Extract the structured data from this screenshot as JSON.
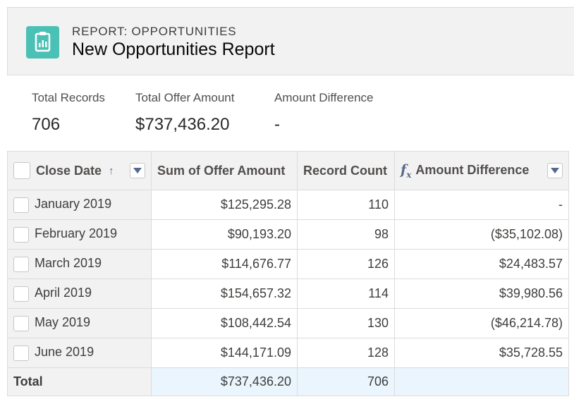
{
  "header": {
    "eyebrow": "REPORT: OPPORTUNITIES",
    "title": "New Opportunities Report",
    "icon": "report-icon",
    "icon_color": "#4bc1b6"
  },
  "summary": [
    {
      "label": "Total Records",
      "value": "706"
    },
    {
      "label": "Total Offer Amount",
      "value": "$737,436.20"
    },
    {
      "label": "Amount Difference",
      "value": "-"
    }
  ],
  "table": {
    "columns": [
      "Close Date",
      "Sum of Offer Amount",
      "Record Count",
      "Amount Difference"
    ],
    "rows": [
      {
        "date": "January 2019",
        "sum": "$125,295.28",
        "count": "110",
        "diff": "-"
      },
      {
        "date": "February 2019",
        "sum": "$90,193.20",
        "count": "98",
        "diff": "($35,102.08)"
      },
      {
        "date": "March 2019",
        "sum": "$114,676.77",
        "count": "126",
        "diff": "$24,483.57"
      },
      {
        "date": "April 2019",
        "sum": "$154,657.32",
        "count": "114",
        "diff": "$39,980.56"
      },
      {
        "date": "May 2019",
        "sum": "$108,442.54",
        "count": "130",
        "diff": "($46,214.78)"
      },
      {
        "date": "June 2019",
        "sum": "$144,171.09",
        "count": "128",
        "diff": "$35,728.55"
      }
    ],
    "total": {
      "label": "Total",
      "sum": "$737,436.20",
      "count": "706",
      "diff": ""
    }
  }
}
